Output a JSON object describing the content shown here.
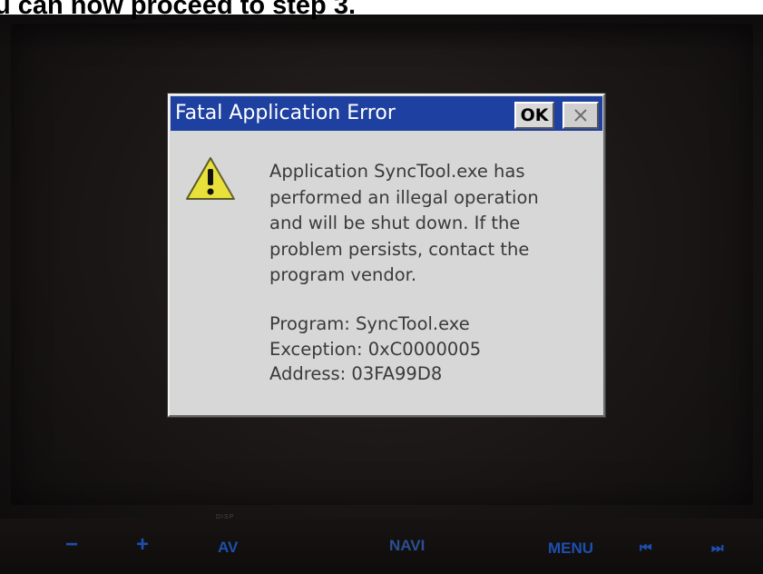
{
  "caption": "u can now proceed to step 3.",
  "dialog": {
    "title": "Fatal Application Error",
    "ok_label": "OK",
    "message_lines": [
      "Application SyncTool.exe has",
      "performed an illegal operation",
      "and will be shut down.  If the",
      "problem persists, contact the",
      "program vendor."
    ],
    "details": {
      "program": "Program: SyncTool.exe",
      "exception": "Exception: 0xC0000005",
      "address": "Address: 03FA99D8"
    },
    "icon": "warning-icon",
    "titlebar_color": "#1e40a0"
  },
  "device": {
    "disp_label": "DISP",
    "buttons": {
      "minus": "−",
      "plus": "+",
      "av": "AV",
      "navi": "NAVI",
      "menu": "MENU",
      "prev": "⏮",
      "next": "⏭"
    },
    "button_color": "#1d4fae"
  }
}
